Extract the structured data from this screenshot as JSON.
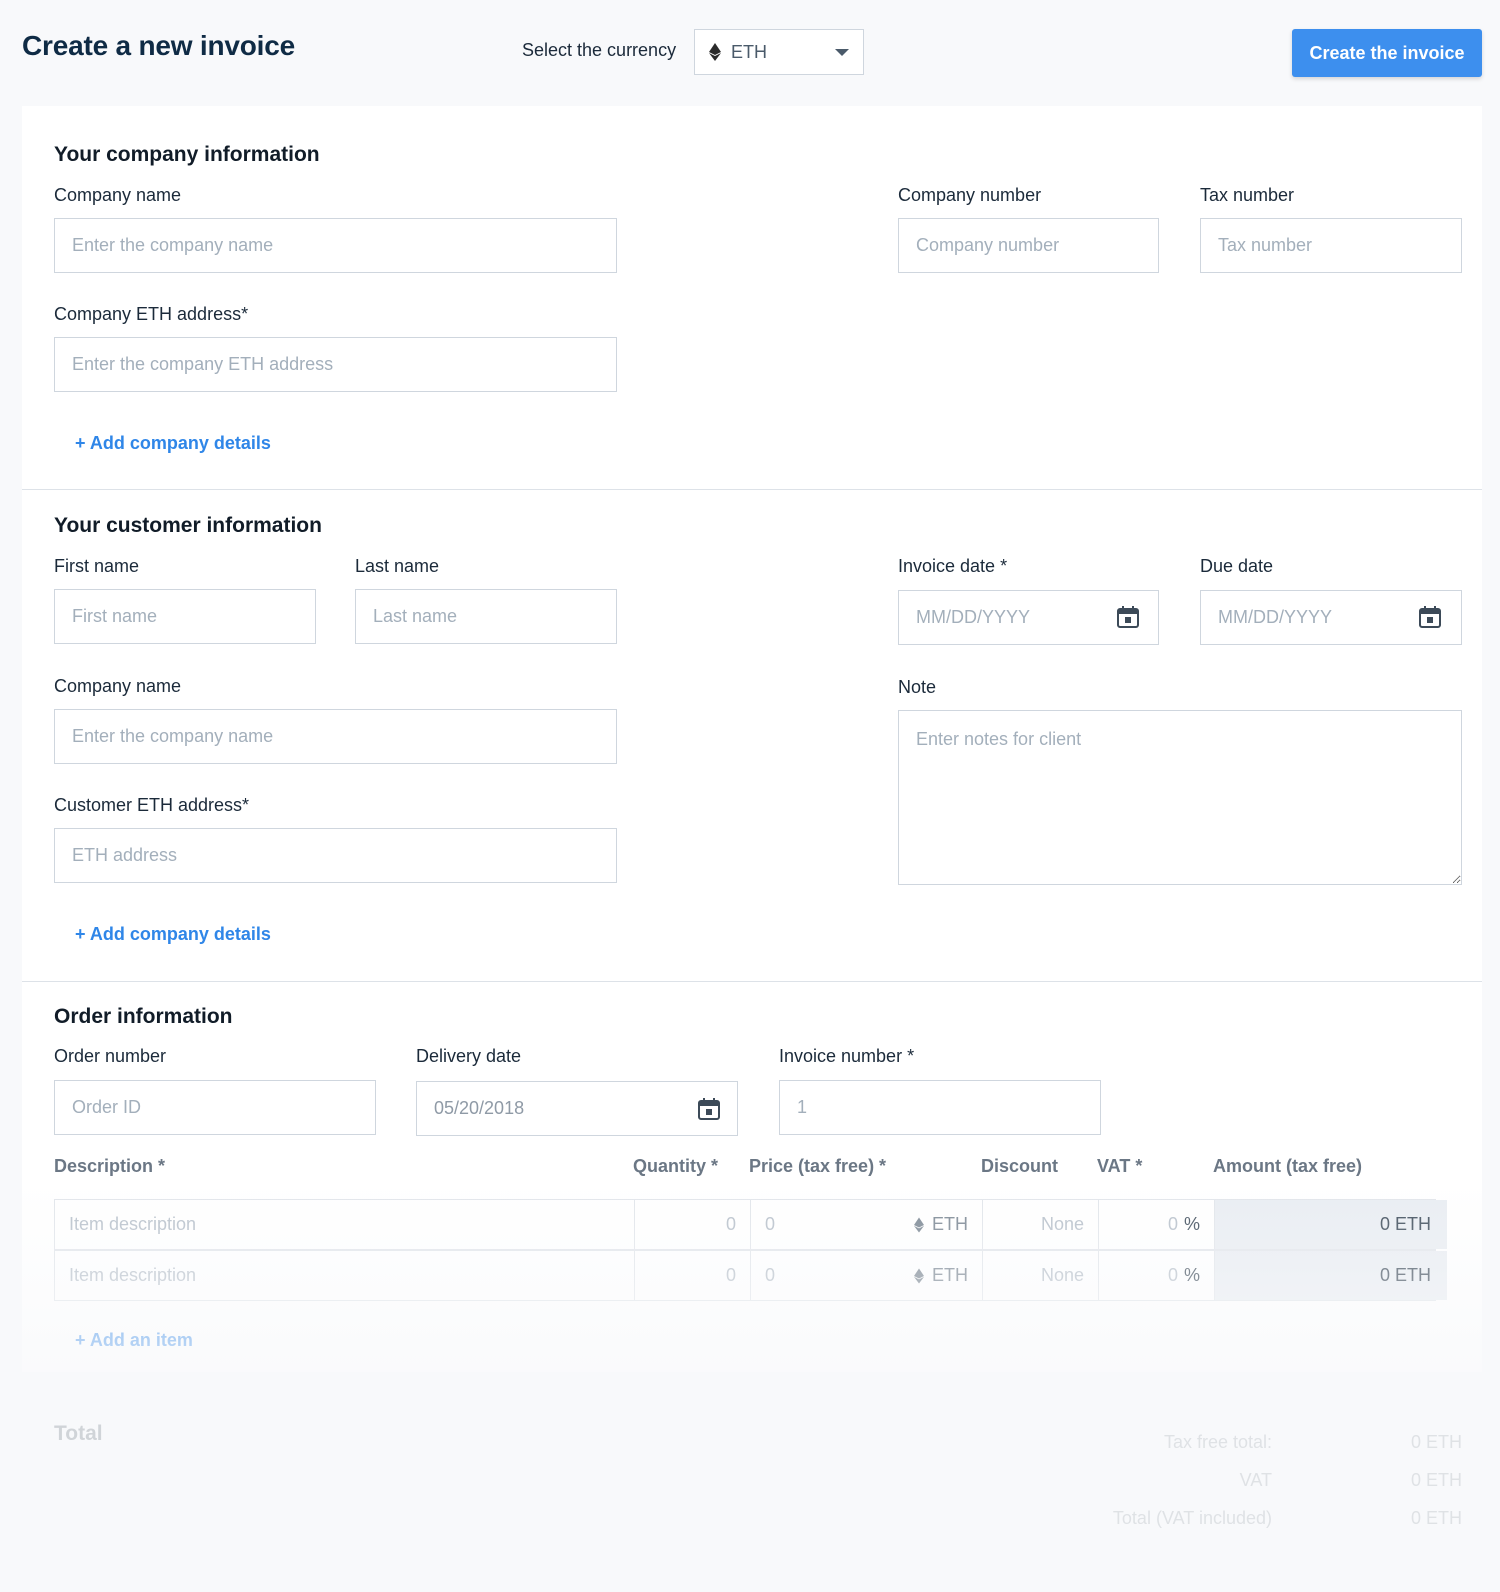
{
  "header": {
    "title": "Create a new invoice",
    "currency_label": "Select the currency",
    "currency_value": "ETH",
    "create_button": "Create the invoice"
  },
  "company_section": {
    "title": "Your company information",
    "company_name_label": "Company name",
    "company_name_placeholder": "Enter the company name",
    "company_number_label": "Company number",
    "company_number_placeholder": "Company number",
    "tax_number_label": "Tax number",
    "tax_number_placeholder": "Tax number",
    "eth_address_label": "Company ETH address*",
    "eth_address_placeholder": "Enter the company ETH address",
    "add_details_link": "+ Add company details"
  },
  "customer_section": {
    "title": "Your customer information",
    "first_name_label": "First name",
    "first_name_placeholder": "First name",
    "last_name_label": "Last name",
    "last_name_placeholder": "Last name",
    "invoice_date_label": "Invoice date *",
    "invoice_date_placeholder": "MM/DD/YYYY",
    "due_date_label": "Due date",
    "due_date_placeholder": "MM/DD/YYYY",
    "company_name_label": "Company name",
    "company_name_placeholder": "Enter the company name",
    "note_label": "Note",
    "note_placeholder": "Enter notes for client",
    "eth_address_label": "Customer ETH address*",
    "eth_address_placeholder": "ETH address",
    "add_details_link": "+ Add company details"
  },
  "order_section": {
    "title": "Order information",
    "order_number_label": "Order number",
    "order_number_placeholder": "Order ID",
    "delivery_date_label": "Delivery date",
    "delivery_date_value": "05/20/2018",
    "invoice_number_label": "Invoice number *",
    "invoice_number_placeholder": "1"
  },
  "items_table": {
    "headers": {
      "description": "Description *",
      "quantity": "Quantity *",
      "price": "Price (tax free) *",
      "discount": "Discount",
      "vat": "VAT *",
      "amount": "Amount (tax free)"
    },
    "rows": [
      {
        "description_placeholder": "Item description",
        "quantity": "0",
        "price": "0",
        "currency": "ETH",
        "discount": "None",
        "vat": "0",
        "vat_unit": "%",
        "amount": "0 ETH"
      },
      {
        "description_placeholder": "Item description",
        "quantity": "0",
        "price": "0",
        "currency": "ETH",
        "discount": "None",
        "vat": "0",
        "vat_unit": "%",
        "amount": "0 ETH"
      }
    ],
    "add_item_link": "+ Add an item"
  },
  "totals": {
    "title": "Total",
    "tax_free_label": "Tax free total:",
    "tax_free_value": "0 ETH",
    "vat_label": "VAT",
    "vat_value": "0 ETH",
    "total_label": "Total (VAT included)",
    "total_value": "0 ETH"
  },
  "colors": {
    "accent": "#3d8fee",
    "link": "#2f86e8",
    "background": "#f8f9fb"
  }
}
